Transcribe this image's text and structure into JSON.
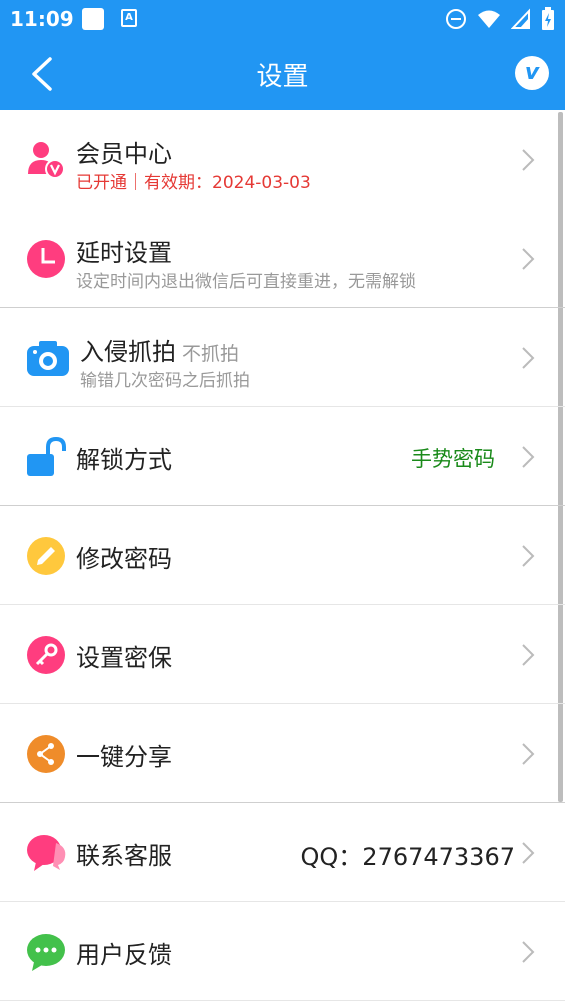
{
  "status_bar": {
    "time": "11:09",
    "a_icon_text": "A"
  },
  "toolbar": {
    "title": "设置",
    "vip_letter": "v"
  },
  "rows": [
    {
      "label": "会员中心",
      "sub": "已开通｜有效期：2024-03-03",
      "icon": "member-icon",
      "color": "#ff3d7f"
    },
    {
      "label": "延时设置",
      "sub": "设定时间内退出微信后可直接重进，无需解锁",
      "icon": "clock-icon",
      "color": "#ff3d7f"
    },
    {
      "label": "入侵抓拍",
      "inline": "不抓拍",
      "sub": "输错几次密码之后抓拍",
      "icon": "camera-icon",
      "color": "#2196f3"
    },
    {
      "label": "解锁方式",
      "value": "手势密码",
      "icon": "unlock-icon",
      "color": "#2196f3"
    },
    {
      "label": "修改密码",
      "icon": "pencil-icon",
      "color": "#ffc107"
    },
    {
      "label": "设置密保",
      "icon": "key-icon",
      "color": "#ff3d7f"
    },
    {
      "label": "一键分享",
      "icon": "share-icon",
      "color": "#ef8c2a"
    },
    {
      "label": "联系客服",
      "value": "QQ：2767473367",
      "icon": "chat-icon",
      "color": "#ff3d7f"
    },
    {
      "label": "用户反馈",
      "icon": "feedback-icon",
      "color": "#43c14b"
    }
  ]
}
